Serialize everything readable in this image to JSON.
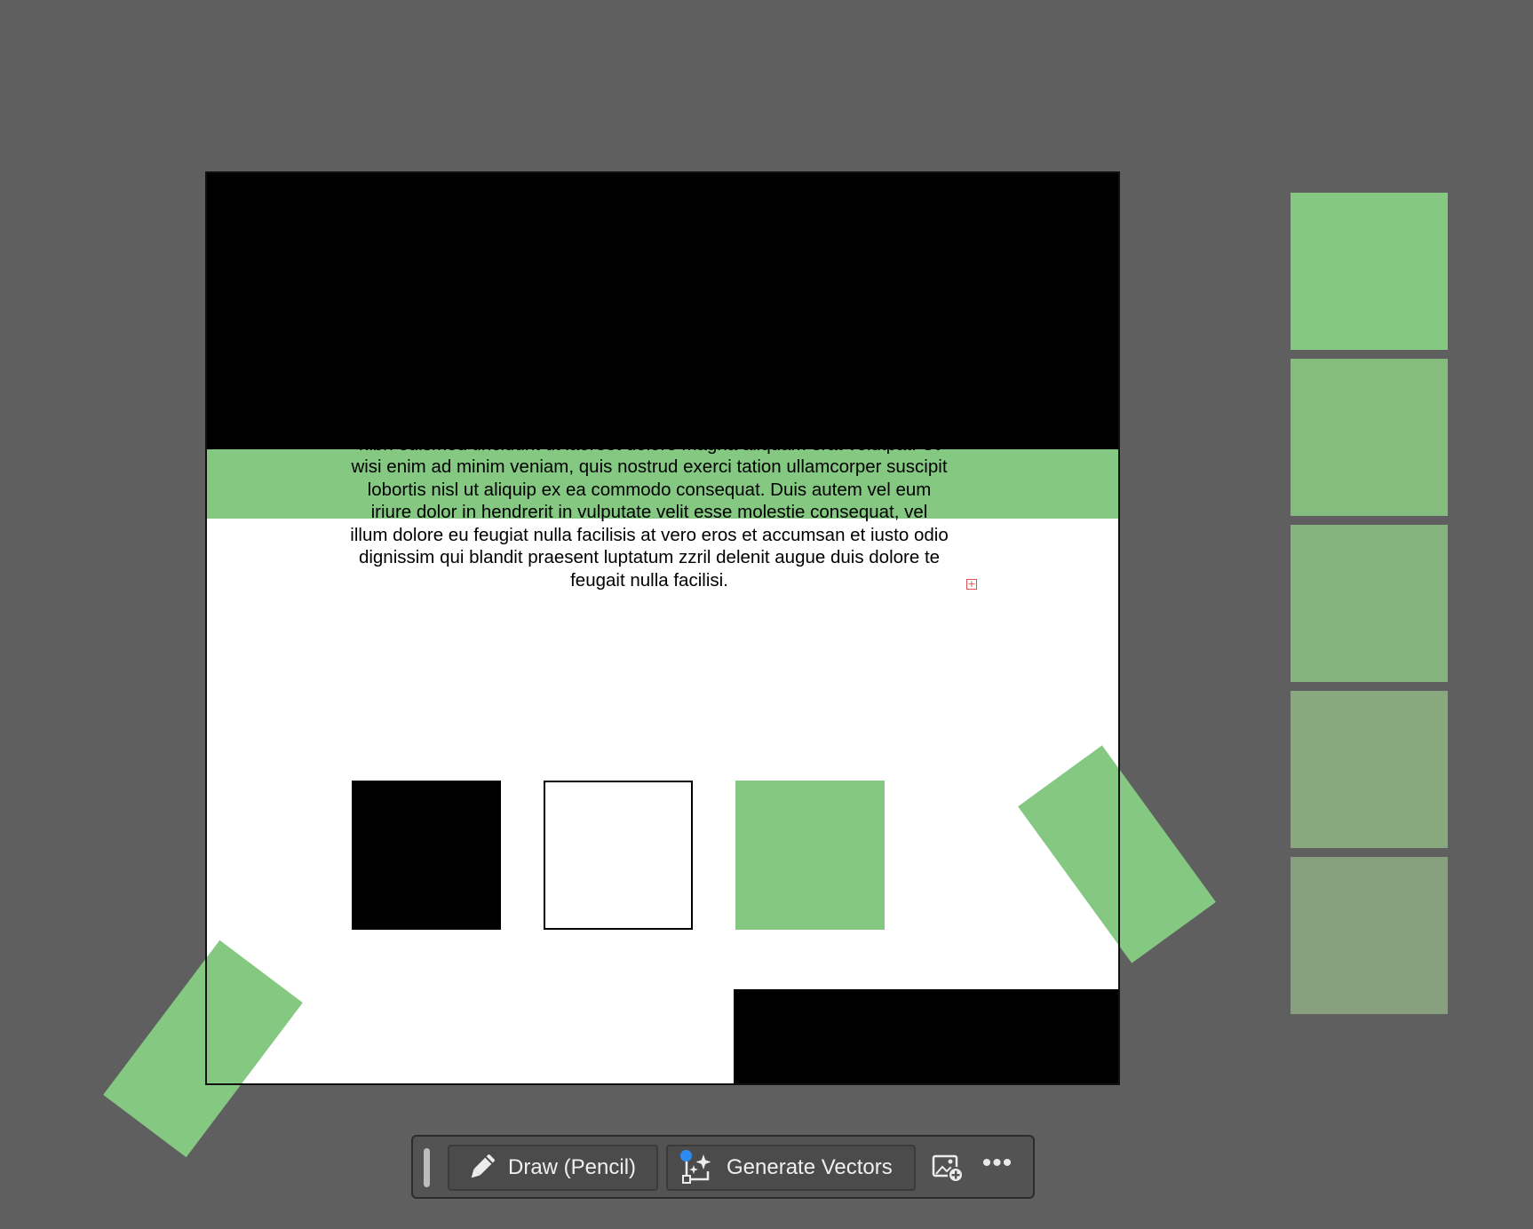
{
  "artboard": {
    "body_text": "nibh euismod tincidunt ut laoreet dolore magna aliquam erat volutpat. Ut wisi enim ad minim veniam, quis nostrud exerci tation ullamcorper suscipit lobortis nisl ut aliquip ex ea commodo consequat. Duis autem vel eum iriure dolor in hendrerit in vulputate velit esse molestie consequat, vel illum dolore eu feugiat nulla facilisis at vero eros et accumsan et iusto odio dignissim qui blandit praesent luptatum zzril delenit augue duis dolore te feugait nulla facilisi.",
    "overflow_marker": "+",
    "colors": {
      "black": "#000000",
      "white": "#ffffff",
      "green": "#84c882"
    }
  },
  "swatches": {
    "colors": [
      "#84c882",
      "#85bd7f",
      "#86b47e",
      "#88a97d",
      "#89a07e"
    ]
  },
  "toolbar": {
    "draw_label": "Draw (Pencil)",
    "draw_icon": "pencil-icon",
    "generate_label": "Generate Vectors",
    "generate_icon": "generate-vectors-icon",
    "place_icon": "place-image-icon",
    "more_label": "•••",
    "accent": "#2d8cf0"
  }
}
